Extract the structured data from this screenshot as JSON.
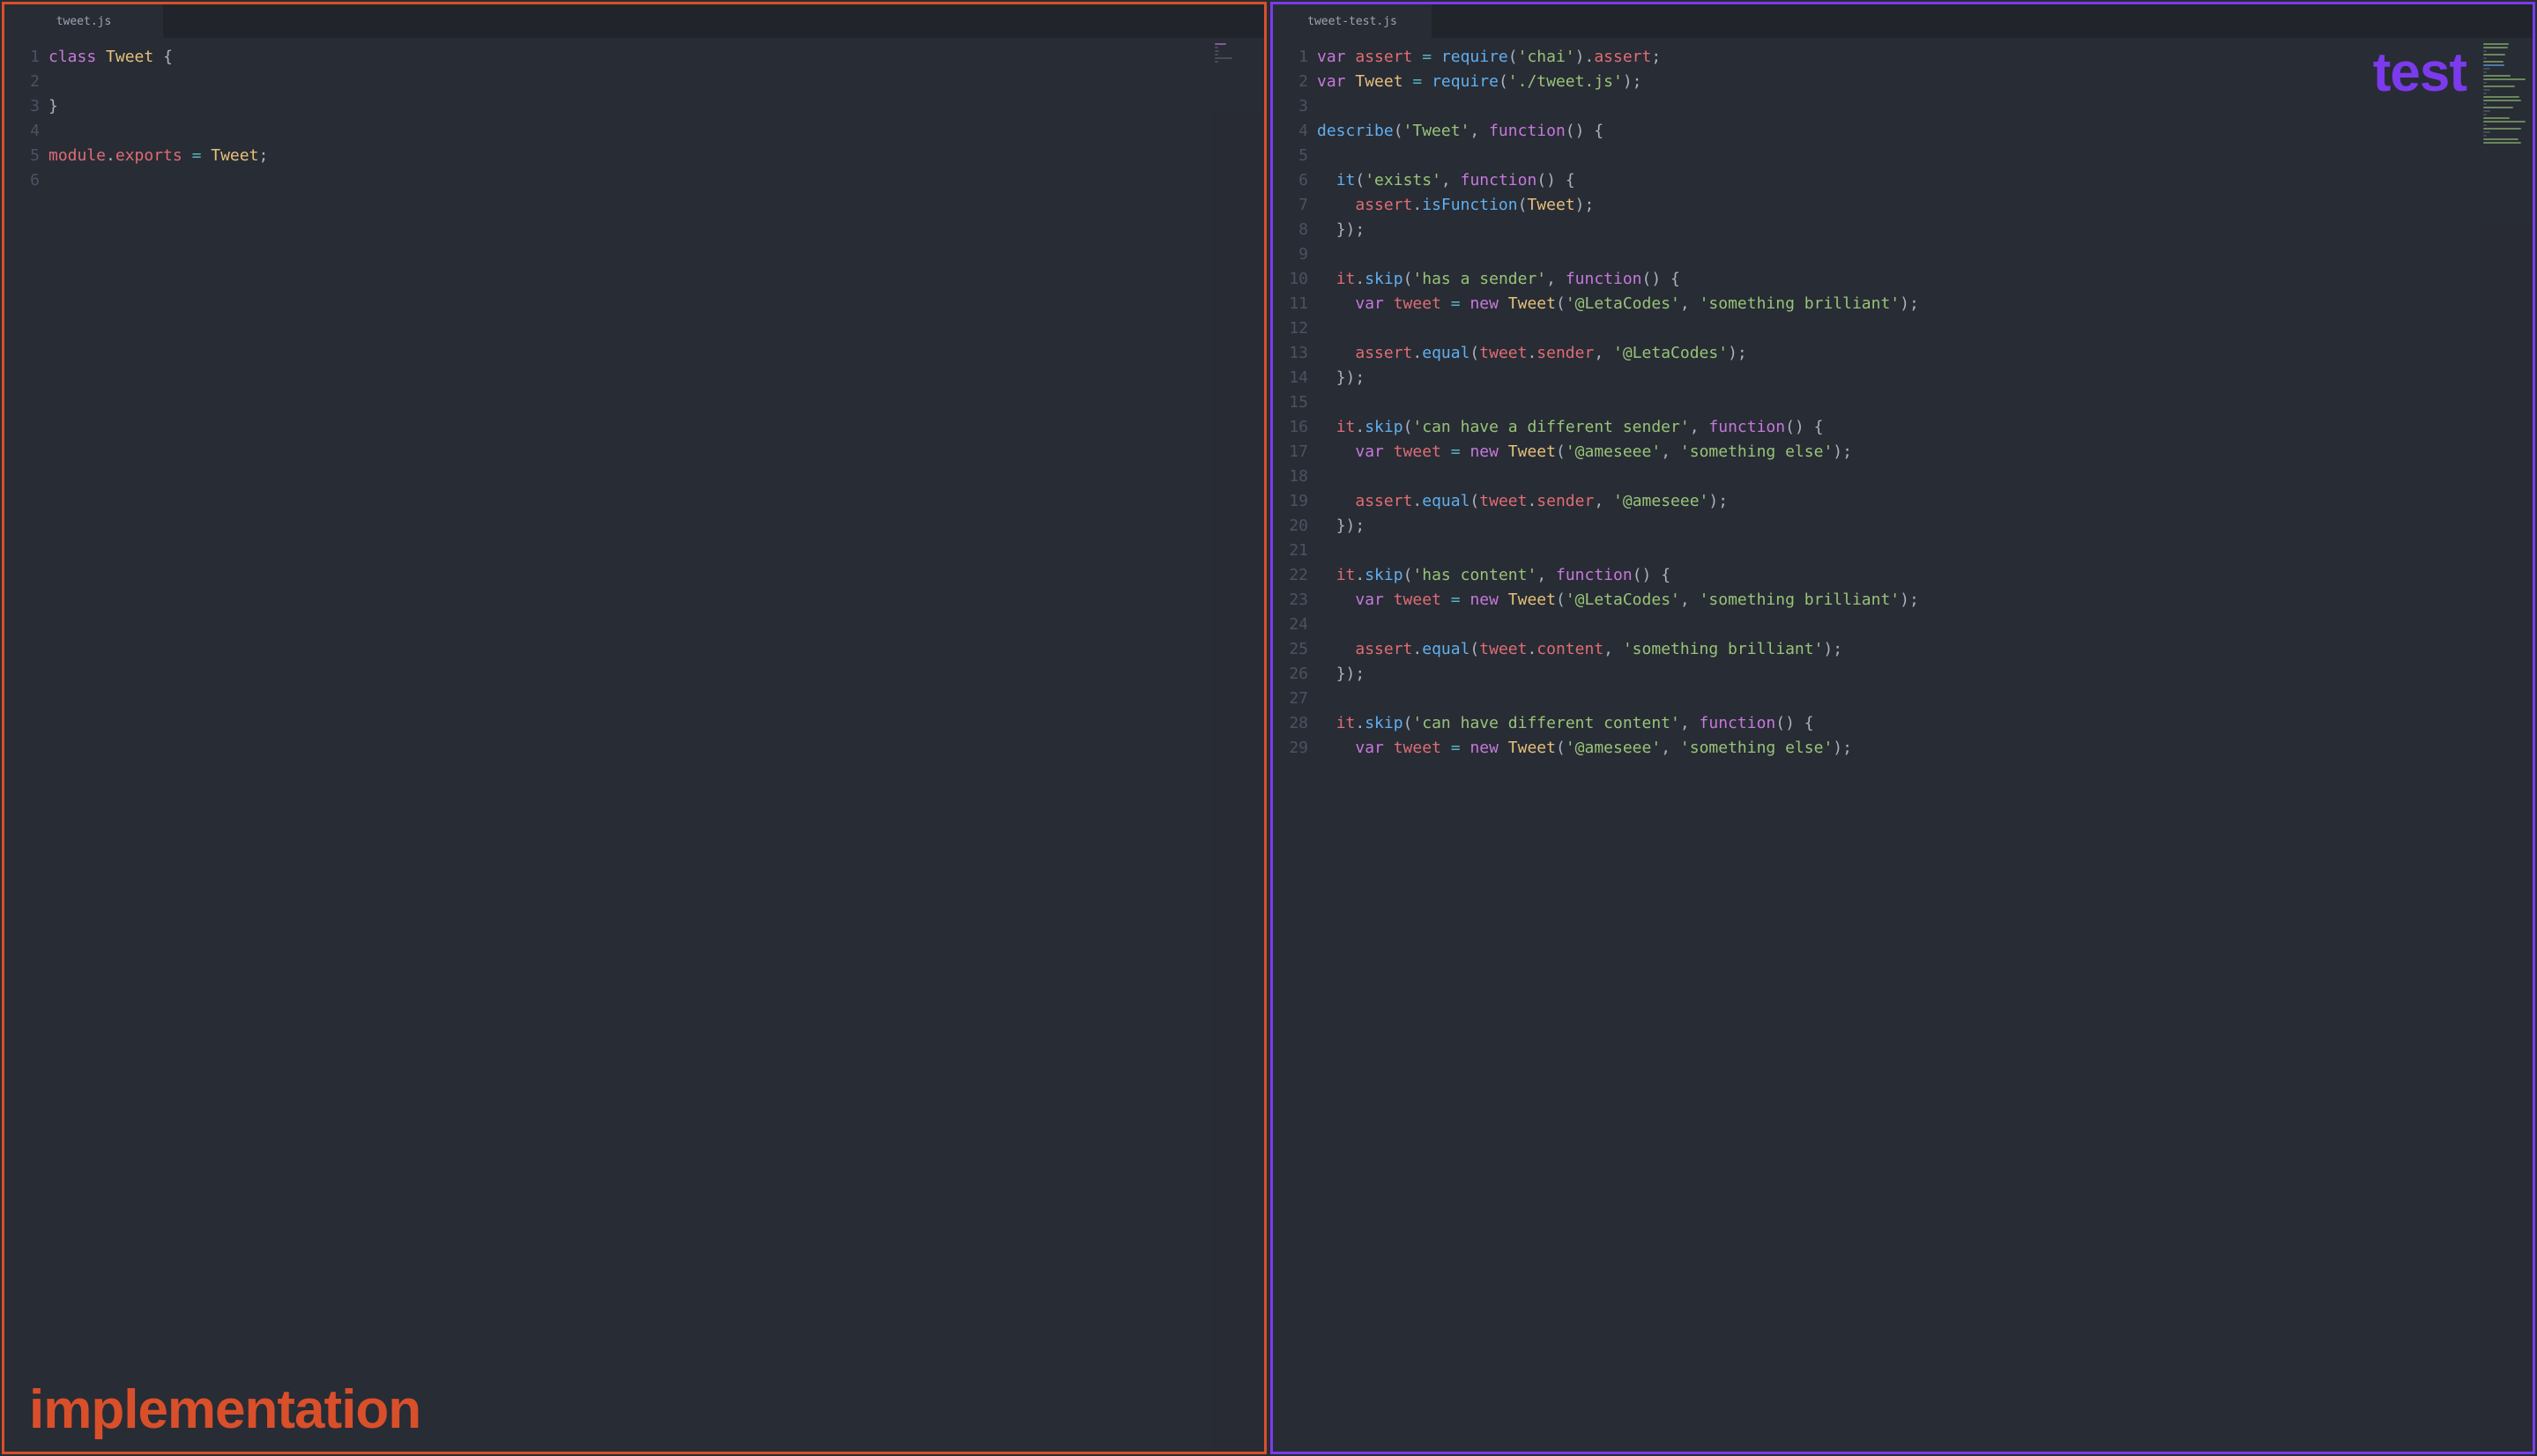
{
  "leftPane": {
    "tab": "tweet.js",
    "overlay": "implementation",
    "lines": [
      [
        {
          "t": "class ",
          "c": "kw"
        },
        {
          "t": "Tweet ",
          "c": "cls"
        },
        {
          "t": "{",
          "c": "punc"
        }
      ],
      [],
      [
        {
          "t": "}",
          "c": "punc"
        }
      ],
      [],
      [
        {
          "t": "module",
          "c": "var"
        },
        {
          "t": ".",
          "c": "punc"
        },
        {
          "t": "exports",
          "c": "prop"
        },
        {
          "t": " = ",
          "c": "op"
        },
        {
          "t": "Tweet",
          "c": "cls"
        },
        {
          "t": ";",
          "c": "punc"
        }
      ],
      []
    ]
  },
  "rightPane": {
    "tab": "tweet-test.js",
    "overlay": "test",
    "lines": [
      [
        {
          "t": "var ",
          "c": "kw"
        },
        {
          "t": "assert ",
          "c": "var"
        },
        {
          "t": "= ",
          "c": "op"
        },
        {
          "t": "require",
          "c": "fn"
        },
        {
          "t": "(",
          "c": "punc"
        },
        {
          "t": "'chai'",
          "c": "str"
        },
        {
          "t": ")",
          "c": "punc"
        },
        {
          "t": ".",
          "c": "punc"
        },
        {
          "t": "assert",
          "c": "prop"
        },
        {
          "t": ";",
          "c": "punc"
        }
      ],
      [
        {
          "t": "var ",
          "c": "kw"
        },
        {
          "t": "Tweet ",
          "c": "cls"
        },
        {
          "t": "= ",
          "c": "op"
        },
        {
          "t": "require",
          "c": "fn"
        },
        {
          "t": "(",
          "c": "punc"
        },
        {
          "t": "'./tweet.js'",
          "c": "str"
        },
        {
          "t": ")",
          "c": "punc"
        },
        {
          "t": ";",
          "c": "punc"
        }
      ],
      [],
      [
        {
          "t": "describe",
          "c": "fn"
        },
        {
          "t": "(",
          "c": "punc"
        },
        {
          "t": "'Tweet'",
          "c": "str"
        },
        {
          "t": ", ",
          "c": "punc"
        },
        {
          "t": "function",
          "c": "kw"
        },
        {
          "t": "() {",
          "c": "punc"
        }
      ],
      [],
      [
        {
          "t": "  ",
          "c": ""
        },
        {
          "t": "it",
          "c": "fn"
        },
        {
          "t": "(",
          "c": "punc"
        },
        {
          "t": "'exists'",
          "c": "str"
        },
        {
          "t": ", ",
          "c": "punc"
        },
        {
          "t": "function",
          "c": "kw"
        },
        {
          "t": "() {",
          "c": "punc"
        }
      ],
      [
        {
          "t": "    ",
          "c": ""
        },
        {
          "t": "assert",
          "c": "var"
        },
        {
          "t": ".",
          "c": "punc"
        },
        {
          "t": "isFunction",
          "c": "fn"
        },
        {
          "t": "(",
          "c": "punc"
        },
        {
          "t": "Tweet",
          "c": "cls"
        },
        {
          "t": ")",
          "c": "punc"
        },
        {
          "t": ";",
          "c": "punc"
        }
      ],
      [
        {
          "t": "  ",
          "c": ""
        },
        {
          "t": "});",
          "c": "punc"
        }
      ],
      [],
      [
        {
          "t": "  ",
          "c": ""
        },
        {
          "t": "it",
          "c": "var"
        },
        {
          "t": ".",
          "c": "punc"
        },
        {
          "t": "skip",
          "c": "fn"
        },
        {
          "t": "(",
          "c": "punc"
        },
        {
          "t": "'has a sender'",
          "c": "str"
        },
        {
          "t": ", ",
          "c": "punc"
        },
        {
          "t": "function",
          "c": "kw"
        },
        {
          "t": "() {",
          "c": "punc"
        }
      ],
      [
        {
          "t": "    ",
          "c": ""
        },
        {
          "t": "var ",
          "c": "kw"
        },
        {
          "t": "tweet ",
          "c": "var"
        },
        {
          "t": "= ",
          "c": "op"
        },
        {
          "t": "new ",
          "c": "kw"
        },
        {
          "t": "Tweet",
          "c": "cls"
        },
        {
          "t": "(",
          "c": "punc"
        },
        {
          "t": "'@LetaCodes'",
          "c": "str"
        },
        {
          "t": ", ",
          "c": "punc"
        },
        {
          "t": "'something brilliant'",
          "c": "str"
        },
        {
          "t": ")",
          "c": "punc"
        },
        {
          "t": ";",
          "c": "punc"
        }
      ],
      [],
      [
        {
          "t": "    ",
          "c": ""
        },
        {
          "t": "assert",
          "c": "var"
        },
        {
          "t": ".",
          "c": "punc"
        },
        {
          "t": "equal",
          "c": "fn"
        },
        {
          "t": "(",
          "c": "punc"
        },
        {
          "t": "tweet",
          "c": "var"
        },
        {
          "t": ".",
          "c": "punc"
        },
        {
          "t": "sender",
          "c": "prop"
        },
        {
          "t": ", ",
          "c": "punc"
        },
        {
          "t": "'@LetaCodes'",
          "c": "str"
        },
        {
          "t": ")",
          "c": "punc"
        },
        {
          "t": ";",
          "c": "punc"
        }
      ],
      [
        {
          "t": "  ",
          "c": ""
        },
        {
          "t": "});",
          "c": "punc"
        }
      ],
      [],
      [
        {
          "t": "  ",
          "c": ""
        },
        {
          "t": "it",
          "c": "var"
        },
        {
          "t": ".",
          "c": "punc"
        },
        {
          "t": "skip",
          "c": "fn"
        },
        {
          "t": "(",
          "c": "punc"
        },
        {
          "t": "'can have a different sender'",
          "c": "str"
        },
        {
          "t": ", ",
          "c": "punc"
        },
        {
          "t": "function",
          "c": "kw"
        },
        {
          "t": "() {",
          "c": "punc"
        }
      ],
      [
        {
          "t": "    ",
          "c": ""
        },
        {
          "t": "var ",
          "c": "kw"
        },
        {
          "t": "tweet ",
          "c": "var"
        },
        {
          "t": "= ",
          "c": "op"
        },
        {
          "t": "new ",
          "c": "kw"
        },
        {
          "t": "Tweet",
          "c": "cls"
        },
        {
          "t": "(",
          "c": "punc"
        },
        {
          "t": "'@ameseee'",
          "c": "str"
        },
        {
          "t": ", ",
          "c": "punc"
        },
        {
          "t": "'something else'",
          "c": "str"
        },
        {
          "t": ")",
          "c": "punc"
        },
        {
          "t": ";",
          "c": "punc"
        }
      ],
      [],
      [
        {
          "t": "    ",
          "c": ""
        },
        {
          "t": "assert",
          "c": "var"
        },
        {
          "t": ".",
          "c": "punc"
        },
        {
          "t": "equal",
          "c": "fn"
        },
        {
          "t": "(",
          "c": "punc"
        },
        {
          "t": "tweet",
          "c": "var"
        },
        {
          "t": ".",
          "c": "punc"
        },
        {
          "t": "sender",
          "c": "prop"
        },
        {
          "t": ", ",
          "c": "punc"
        },
        {
          "t": "'@ameseee'",
          "c": "str"
        },
        {
          "t": ")",
          "c": "punc"
        },
        {
          "t": ";",
          "c": "punc"
        }
      ],
      [
        {
          "t": "  ",
          "c": ""
        },
        {
          "t": "});",
          "c": "punc"
        }
      ],
      [],
      [
        {
          "t": "  ",
          "c": ""
        },
        {
          "t": "it",
          "c": "var"
        },
        {
          "t": ".",
          "c": "punc"
        },
        {
          "t": "skip",
          "c": "fn"
        },
        {
          "t": "(",
          "c": "punc"
        },
        {
          "t": "'has content'",
          "c": "str"
        },
        {
          "t": ", ",
          "c": "punc"
        },
        {
          "t": "function",
          "c": "kw"
        },
        {
          "t": "() {",
          "c": "punc"
        }
      ],
      [
        {
          "t": "    ",
          "c": ""
        },
        {
          "t": "var ",
          "c": "kw"
        },
        {
          "t": "tweet ",
          "c": "var"
        },
        {
          "t": "= ",
          "c": "op"
        },
        {
          "t": "new ",
          "c": "kw"
        },
        {
          "t": "Tweet",
          "c": "cls"
        },
        {
          "t": "(",
          "c": "punc"
        },
        {
          "t": "'@LetaCodes'",
          "c": "str"
        },
        {
          "t": ", ",
          "c": "punc"
        },
        {
          "t": "'something brilliant'",
          "c": "str"
        },
        {
          "t": ")",
          "c": "punc"
        },
        {
          "t": ";",
          "c": "punc"
        }
      ],
      [],
      [
        {
          "t": "    ",
          "c": ""
        },
        {
          "t": "assert",
          "c": "var"
        },
        {
          "t": ".",
          "c": "punc"
        },
        {
          "t": "equal",
          "c": "fn"
        },
        {
          "t": "(",
          "c": "punc"
        },
        {
          "t": "tweet",
          "c": "var"
        },
        {
          "t": ".",
          "c": "punc"
        },
        {
          "t": "content",
          "c": "prop"
        },
        {
          "t": ", ",
          "c": "punc"
        },
        {
          "t": "'something brilliant'",
          "c": "str"
        },
        {
          "t": ")",
          "c": "punc"
        },
        {
          "t": ";",
          "c": "punc"
        }
      ],
      [
        {
          "t": "  ",
          "c": ""
        },
        {
          "t": "});",
          "c": "punc"
        }
      ],
      [],
      [
        {
          "t": "  ",
          "c": ""
        },
        {
          "t": "it",
          "c": "var"
        },
        {
          "t": ".",
          "c": "punc"
        },
        {
          "t": "skip",
          "c": "fn"
        },
        {
          "t": "(",
          "c": "punc"
        },
        {
          "t": "'can have different content'",
          "c": "str"
        },
        {
          "t": ", ",
          "c": "punc"
        },
        {
          "t": "function",
          "c": "kw"
        },
        {
          "t": "() {",
          "c": "punc"
        }
      ],
      [
        {
          "t": "    ",
          "c": ""
        },
        {
          "t": "var ",
          "c": "kw"
        },
        {
          "t": "tweet ",
          "c": "var"
        },
        {
          "t": "= ",
          "c": "op"
        },
        {
          "t": "new ",
          "c": "kw"
        },
        {
          "t": "Tweet",
          "c": "cls"
        },
        {
          "t": "(",
          "c": "punc"
        },
        {
          "t": "'@ameseee'",
          "c": "str"
        },
        {
          "t": ", ",
          "c": "punc"
        },
        {
          "t": "'something else'",
          "c": "str"
        },
        {
          "t": ")",
          "c": "punc"
        },
        {
          "t": ";",
          "c": "punc"
        }
      ]
    ]
  }
}
